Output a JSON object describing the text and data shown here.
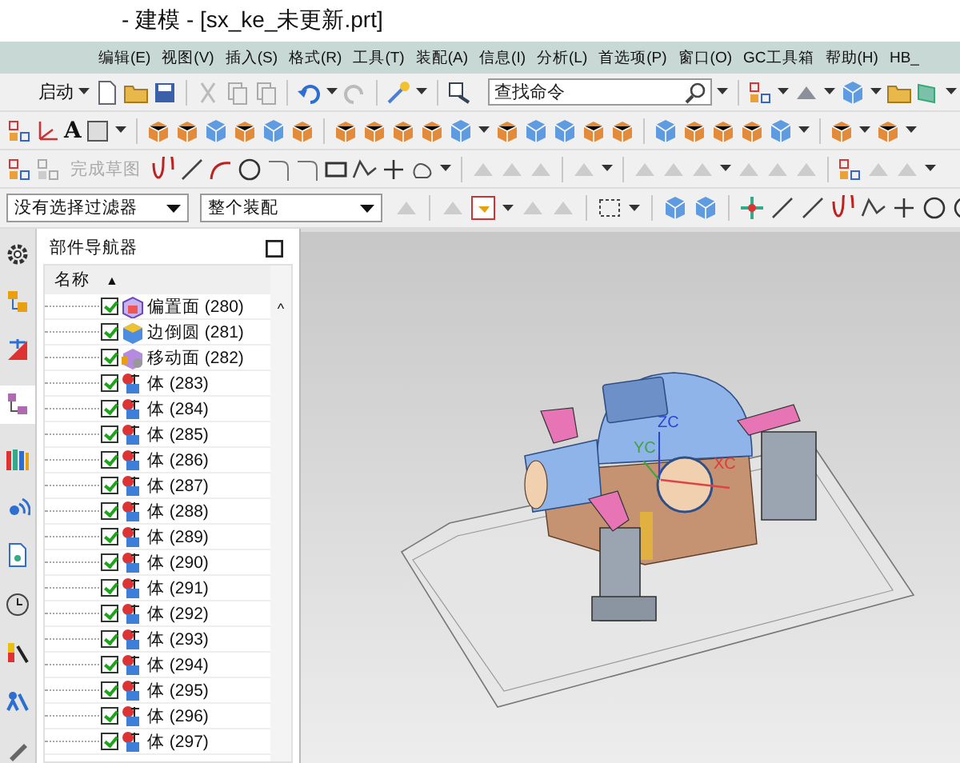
{
  "window": {
    "title": "- 建模 - [sx_ke_未更新.prt]"
  },
  "menu": [
    "编辑(E)",
    "视图(V)",
    "插入(S)",
    "格式(R)",
    "工具(T)",
    "装配(A)",
    "信息(I)",
    "分析(L)",
    "首选项(P)",
    "窗口(O)",
    "GC工具箱",
    "帮助(H)",
    "HB_"
  ],
  "toolbar": {
    "start_label": "启动",
    "search": {
      "placeholder": "查找命令"
    },
    "text_tool_glyph": "A",
    "finish_sketch": {
      "label": "完成草图",
      "disabled": true
    }
  },
  "filters": [
    {
      "value": "没有选择过滤器"
    },
    {
      "value": "整个装配"
    }
  ],
  "resource_bar": [
    {
      "selected": false
    },
    {
      "selected": false
    },
    {
      "selected": false
    },
    {
      "selected": true
    },
    {
      "selected": false
    },
    {
      "selected": false
    },
    {
      "selected": false
    },
    {
      "selected": false
    },
    {
      "selected": false
    },
    {
      "selected": false
    },
    {
      "selected": false
    }
  ],
  "navigator": {
    "title": "部件导航器",
    "column": "名称",
    "sort_glyph": "▲",
    "scroll_glyph": "^",
    "rows": [
      {
        "kind": "offset",
        "label": "偏置面 (280)",
        "checked": true
      },
      {
        "kind": "blend",
        "label": "边倒圆 (281)",
        "checked": true
      },
      {
        "kind": "move",
        "label": "移动面 (282)",
        "checked": true
      },
      {
        "kind": "body",
        "label": "体 (283)",
        "checked": true
      },
      {
        "kind": "body",
        "label": "体 (284)",
        "checked": true
      },
      {
        "kind": "body",
        "label": "体 (285)",
        "checked": true
      },
      {
        "kind": "body",
        "label": "体 (286)",
        "checked": true
      },
      {
        "kind": "body",
        "label": "体 (287)",
        "checked": true
      },
      {
        "kind": "body",
        "label": "体 (288)",
        "checked": true
      },
      {
        "kind": "body",
        "label": "体 (289)",
        "checked": true
      },
      {
        "kind": "body",
        "label": "体 (290)",
        "checked": true
      },
      {
        "kind": "body",
        "label": "体 (291)",
        "checked": true
      },
      {
        "kind": "body",
        "label": "体 (292)",
        "checked": true
      },
      {
        "kind": "body",
        "label": "体 (293)",
        "checked": true
      },
      {
        "kind": "body",
        "label": "体 (294)",
        "checked": true
      },
      {
        "kind": "body",
        "label": "体 (295)",
        "checked": true
      },
      {
        "kind": "body",
        "label": "体 (296)",
        "checked": true
      },
      {
        "kind": "body",
        "label": "体 (297)",
        "checked": true
      }
    ]
  },
  "viewport": {
    "axes": [
      {
        "label": "ZC",
        "color": "#2b44d8"
      },
      {
        "label": "YC",
        "color": "#3fa33f"
      },
      {
        "label": "XC",
        "color": "#e03a3a"
      }
    ]
  }
}
